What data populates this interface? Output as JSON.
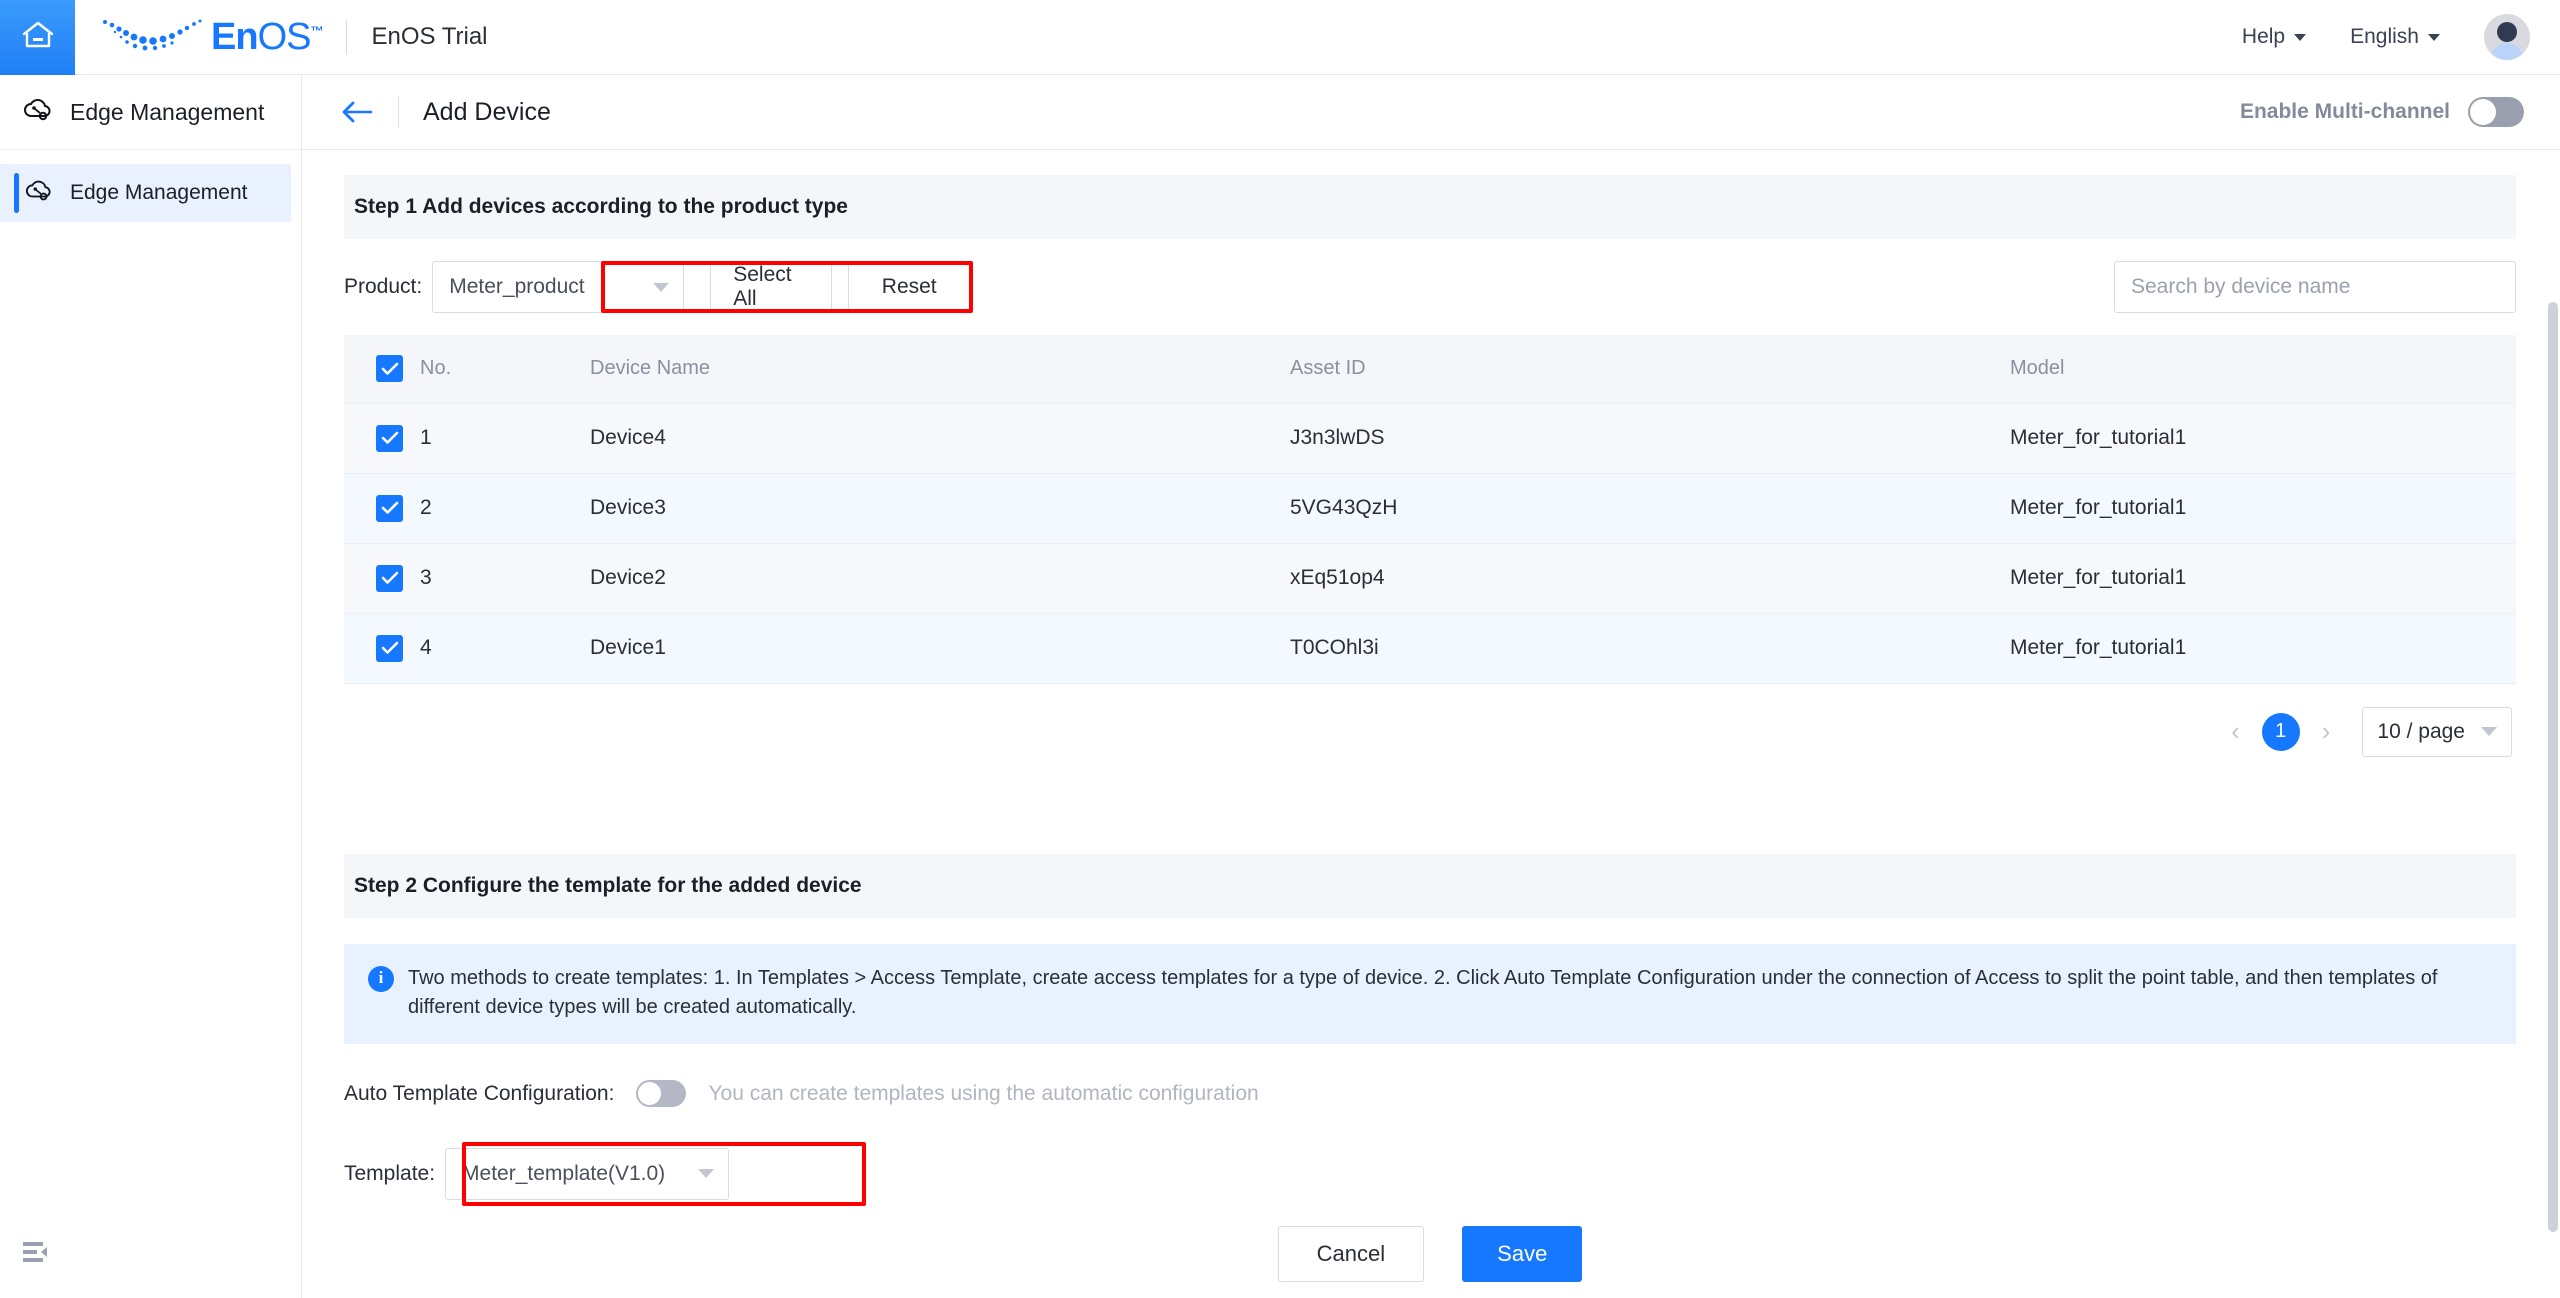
{
  "topbar": {
    "home_icon": "home-icon",
    "brand_en": "En",
    "brand_os": "OS",
    "brand_tm": "™",
    "tenant": "EnOS Trial",
    "help": "Help",
    "language": "English"
  },
  "sidebar": {
    "title": "Edge Management",
    "items": [
      {
        "label": "Edge Management",
        "icon": "edge-cloud-icon",
        "active": true
      }
    ],
    "collapse_icon": "collapse-sidebar-icon"
  },
  "page_header": {
    "back_icon": "back-arrow-icon",
    "title": "Add Device",
    "multichannel_label": "Enable Multi-channel",
    "multichannel_on": false
  },
  "step1": {
    "heading": "Step 1 Add devices according to the product type",
    "product_label": "Product:",
    "product_value": "Meter_product",
    "select_all_label": "Select All",
    "reset_label": "Reset",
    "search_placeholder": "Search by device name",
    "search_value": "",
    "highlight_color": "#ff0000",
    "table": {
      "columns": [
        "No.",
        "Device Name",
        "Asset ID",
        "Model"
      ],
      "header_checked": true,
      "rows": [
        {
          "checked": true,
          "no": "1",
          "device_name": "Device4",
          "asset_id": "J3n3lwDS",
          "model": "Meter_for_tutorial1"
        },
        {
          "checked": true,
          "no": "2",
          "device_name": "Device3",
          "asset_id": "5VG43QzH",
          "model": "Meter_for_tutorial1"
        },
        {
          "checked": true,
          "no": "3",
          "device_name": "Device2",
          "asset_id": "xEq51op4",
          "model": "Meter_for_tutorial1"
        },
        {
          "checked": true,
          "no": "4",
          "device_name": "Device1",
          "asset_id": "T0COhl3i",
          "model": "Meter_for_tutorial1"
        }
      ]
    },
    "pagination": {
      "prev": "‹",
      "current_page": "1",
      "next": "›",
      "page_size": "10 / page"
    }
  },
  "step2": {
    "heading": "Step 2 Configure the template for the added device",
    "info_icon": "info-icon",
    "info_text": "Two methods to create templates: 1. In Templates > Access Template, create access templates for a type of device. 2. Click Auto Template Configuration under the connection of Access to split the point table, and then templates of different device types will be created automatically.",
    "auto_label": "Auto Template Configuration:",
    "auto_on": false,
    "auto_hint": "You can create templates using the automatic configuration",
    "template_label": "Template:",
    "template_value": "Meter_template(V1.0)"
  },
  "footer": {
    "cancel_label": "Cancel",
    "save_label": "Save",
    "primary_color": "#1677ff"
  }
}
